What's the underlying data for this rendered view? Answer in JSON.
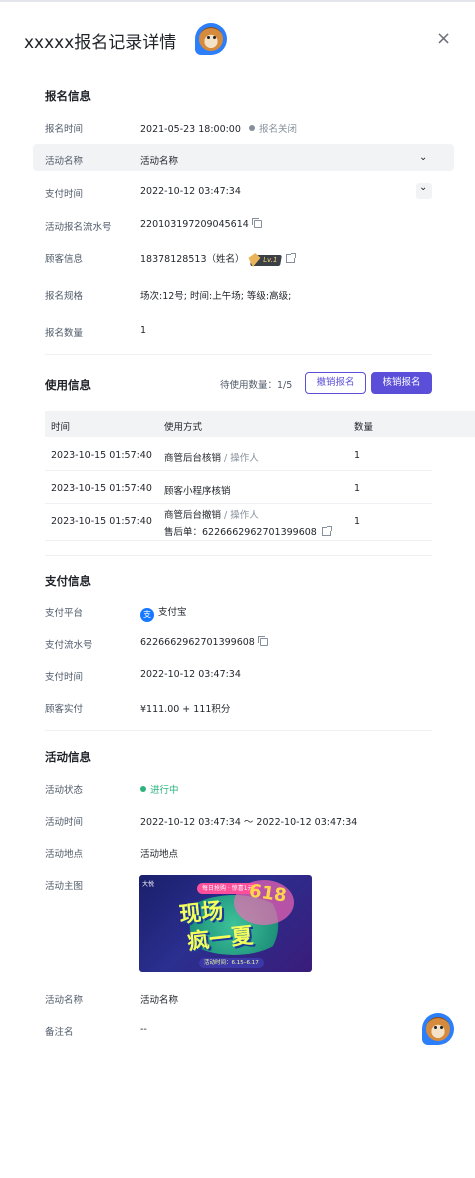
{
  "header": {
    "title": "xxxxx报名记录详情",
    "close_icon": "×"
  },
  "signup_info": {
    "section_title": "报名信息",
    "fields": {
      "signup_time": {
        "label": "报名时间",
        "value": "2021-05-23 18:00:00",
        "status": "报名关闭"
      },
      "activity_name": {
        "label": "活动名称",
        "value": "活动名称"
      },
      "pay_time": {
        "label": "支付时间",
        "value": "2022-10-12 03:47:34"
      },
      "serial_no": {
        "label": "活动报名流水号",
        "value": "220103197209045614"
      },
      "customer": {
        "label": "顾客信息",
        "value": "18378128513（姓名）",
        "level": "Lv.1"
      },
      "spec": {
        "label": "报名规格",
        "value": "场次:12号;  时间:上午场;  等级:高级;"
      },
      "quantity": {
        "label": "报名数量",
        "value": "1"
      }
    }
  },
  "usage_info": {
    "section_title": "使用信息",
    "waiting": "待使用数量：1/5",
    "cancel_button": "撤销报名",
    "verify_button": "核销报名",
    "columns": [
      "时间",
      "使用方式",
      "数量"
    ],
    "rows": [
      {
        "time": "2023-10-15 01:57:40",
        "method": "商管后台核销",
        "operator": "/ 操作人",
        "qty": "1"
      },
      {
        "time": "2023-10-15 01:57:40",
        "method": "顾客小程序核销",
        "qty": "1"
      },
      {
        "time": "2023-10-15 01:57:40",
        "method": "商管后台撤销",
        "operator": "/ 操作人",
        "after_sale": "售后单：6226662962701399608",
        "qty": "1"
      }
    ]
  },
  "payment_info": {
    "section_title": "支付信息",
    "platform": {
      "label": "支付平台",
      "value": "支付宝",
      "icon": "支"
    },
    "serial": {
      "label": "支付流水号",
      "value": "6226662962701399608"
    },
    "time": {
      "label": "支付时间",
      "value": "2022-10-12 03:47:34"
    },
    "paid": {
      "label": "顾客实付",
      "value": "¥111.00 + 111积分"
    }
  },
  "activity_info": {
    "section_title": "活动信息",
    "status": {
      "label": "活动状态",
      "value": "进行中"
    },
    "time": {
      "label": "活动时间",
      "value": "2022-10-12 03:47:34 ～ 2022-10-12 03:47:34"
    },
    "place": {
      "label": "活动地点",
      "value": "活动地点"
    },
    "poster": {
      "label": "活动主图",
      "logo": "大悦",
      "tag": "每日抢购 · 惊喜1元",
      "line1": "现场",
      "line2": "疯一夏",
      "number": "618",
      "dates": "活动时间：6.15–6.17"
    },
    "name": {
      "label": "活动名称",
      "value": "活动名称"
    },
    "remark": {
      "label": "备注名",
      "value": "--"
    }
  },
  "colors": {
    "primary": "#5b4fd9",
    "success": "#2db47d",
    "alipay": "#1677ff",
    "muted_dot": "#86909c"
  }
}
